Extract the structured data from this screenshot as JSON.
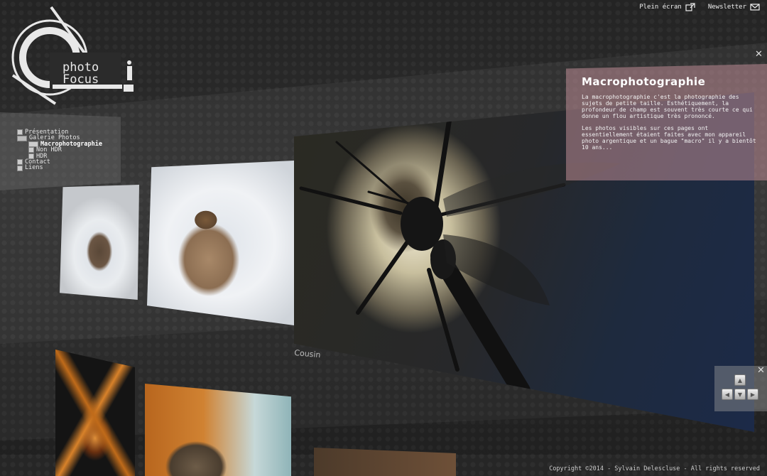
{
  "header": {
    "fullscreen_label": "Plein écran",
    "newsletter_label": "Newsletter",
    "fullscreen_icon": "external-window-icon",
    "newsletter_icon": "envelope-icon"
  },
  "logo": {
    "line1": "photo",
    "line2": "Focus"
  },
  "menu": {
    "items": [
      {
        "label": "Présentation"
      },
      {
        "label": "Galerie Photos"
      },
      {
        "label": "Macrophotographie"
      },
      {
        "label": "Non HDR"
      },
      {
        "label": "HDR"
      },
      {
        "label": "Contact"
      },
      {
        "label": "Liens"
      }
    ]
  },
  "gallery": {
    "main_caption": "Cousin"
  },
  "info": {
    "title": "Macrophotographie",
    "para1": "La macrophotographie c'est la photographie des sujets de petite taille. Esthétiquement, la profondeur de champ est souvent très courte ce qui donne un flou artistique très prononcé.",
    "para2": "Les photos visibles sur ces pages ont essentiellement étaient faites avec mon appareil photo argentique et un bague \"macro\" il y a bientôt 10 ans..."
  },
  "footer": {
    "copyright": "Copyright ©2014 - Sylvain Delescluse - All rights reserved"
  },
  "colors": {
    "info_panel": "#be8c96",
    "background": "#2b2b2b"
  }
}
